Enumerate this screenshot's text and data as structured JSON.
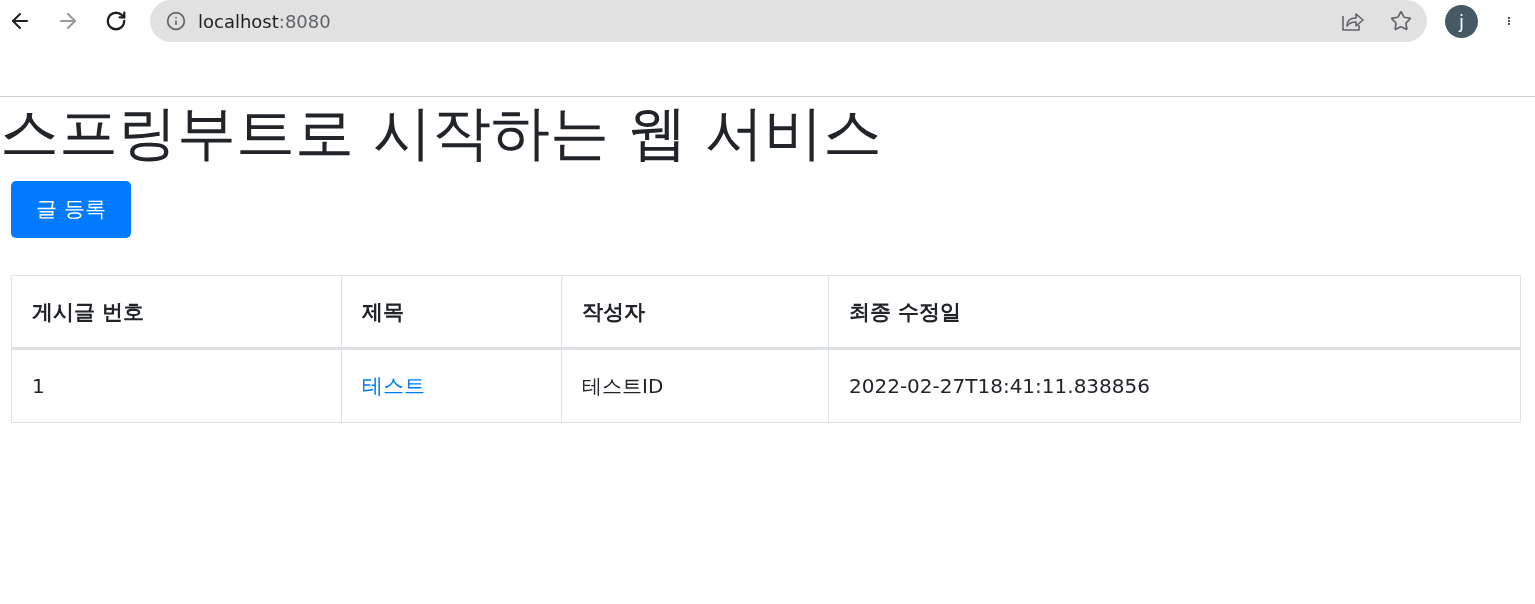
{
  "browser": {
    "nav_buttons": [
      {
        "kind": "back",
        "disabled": false
      },
      {
        "kind": "forward",
        "disabled": true
      },
      {
        "kind": "reload",
        "disabled": false
      }
    ],
    "url": {
      "host": "localhost",
      "port": ":8080"
    },
    "avatar": "j"
  },
  "page": {
    "title": "스프링부트로 시작하는 웹 서비스",
    "button": "글 등록"
  },
  "table": {
    "columns": [
      "게시글 번호",
      "제목",
      "작성자",
      "최종 수정일"
    ],
    "rows": [
      {
        "cells": [
          {
            "kind": "text",
            "text": "1"
          },
          {
            "kind": "link",
            "text": "테스트"
          },
          {
            "kind": "text",
            "text": "테스트ID"
          },
          {
            "kind": "text",
            "text": "2022-02-27T18:41:11.838856"
          }
        ]
      }
    ]
  }
}
